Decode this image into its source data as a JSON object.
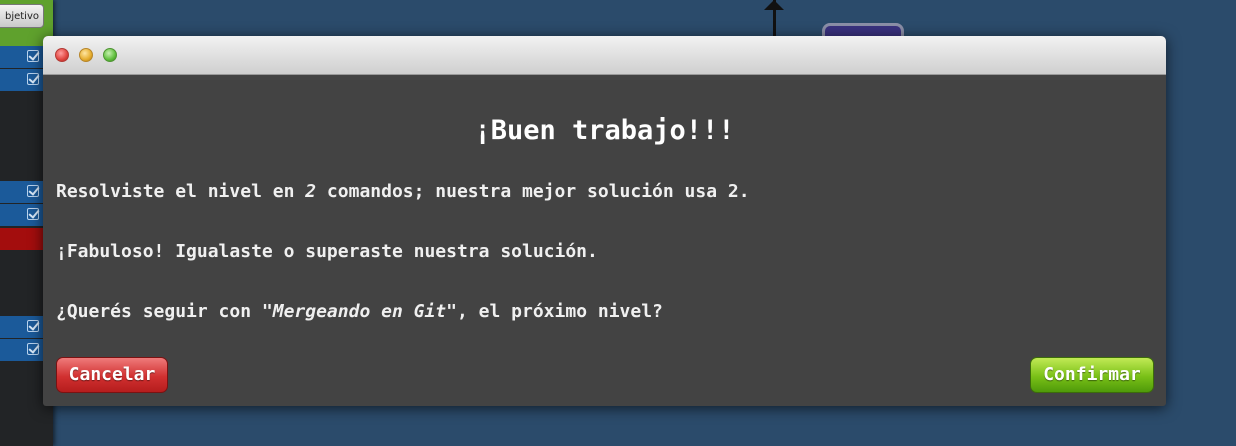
{
  "sidebar": {
    "objective_label": "bjetivo",
    "rows": [
      {
        "style": "blue",
        "icon": "checkbox-checked-icon"
      },
      {
        "style": "blue",
        "icon": "checkbox-checked-icon"
      },
      {
        "style": "blue",
        "icon": "checkbox-checked-icon"
      },
      {
        "style": "blue",
        "icon": "checkbox-checked-icon"
      },
      {
        "style": "red"
      },
      {
        "style": "blue",
        "icon": "checkbox-checked-icon"
      },
      {
        "style": "blue",
        "icon": "checkbox-checked-icon"
      }
    ]
  },
  "dialog": {
    "title": "¡Buen trabajo!!!",
    "line1_prefix": "Resolviste el nivel en ",
    "line1_count": "2",
    "line1_suffix": " comandos; nuestra mejor solución usa 2.",
    "line2": "¡Fabuloso! Igualaste o superaste nuestra solución.",
    "line3_prefix": "¿Querés seguir con ",
    "line3_level": "\"Mergeando en Git\"",
    "line3_suffix": ", el próximo nivel?",
    "cancel_label": "Cancelar",
    "confirm_label": "Confirmar"
  },
  "colors": {
    "background": "#2b4b6b",
    "dialog_body": "#434343",
    "cancel": "#d13030",
    "confirm": "#79c017",
    "command_row_blue": "#1b5a9a",
    "command_row_red": "#a30d0d"
  }
}
